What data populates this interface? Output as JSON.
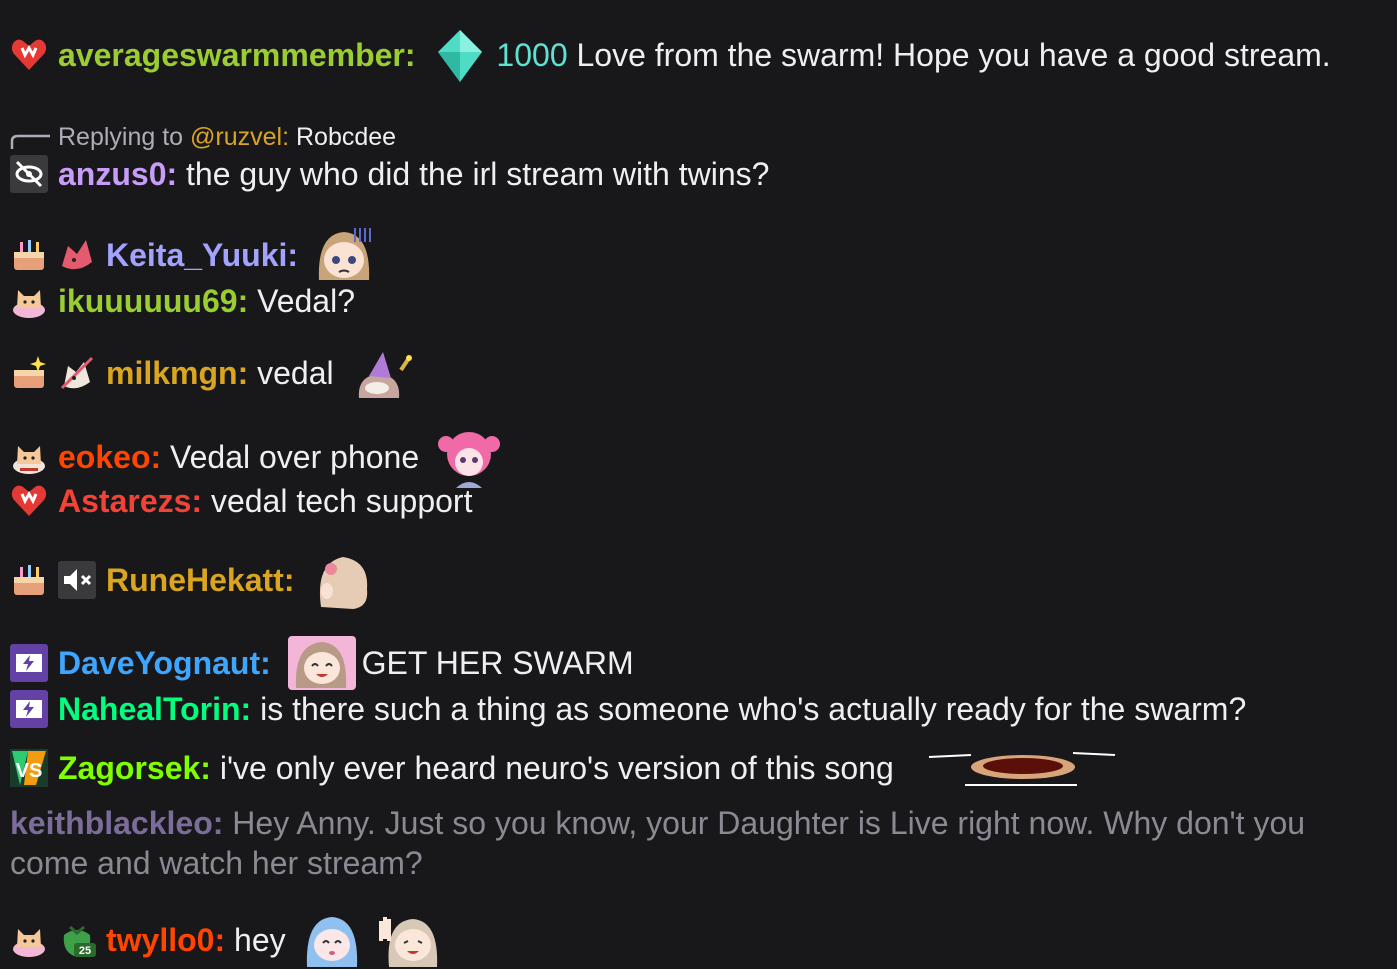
{
  "colors": {
    "background": "#18181b",
    "text": "#efeff1",
    "reply_text": "#adadb8",
    "faded_text": "#8a8a93"
  },
  "messages": [
    {
      "id": "m1",
      "badges": [
        "heart-badge-icon"
      ],
      "user": "averageswarmmember:",
      "user_color": "#9acd32",
      "bits_icon": "bits-gem-icon",
      "bits": "1000",
      "bits_color": "#5ee2d2",
      "text": "Love from the swarm! Hope you have a good stream."
    },
    {
      "id": "m2",
      "reply": {
        "prefix": "Replying to",
        "mention": "@ruzvel:",
        "text": "Robcdee"
      },
      "badges": [
        "eye-slash-badge-icon"
      ],
      "user": "anzus0:",
      "user_color": "#c89df8",
      "text": "the guy who did the irl stream with twins?"
    },
    {
      "id": "m3",
      "badges": [
        "cake-badge-icon",
        "fox-badge-icon"
      ],
      "user": "Keita_Yuuki:",
      "user_color": "#a3a3ff",
      "emotes": [
        "anime-girl-stressed-emote"
      ],
      "text": ""
    },
    {
      "id": "m4",
      "badges": [
        "cat-cake-badge-icon"
      ],
      "user": "ikuuuuuu69:",
      "user_color": "#9acd32",
      "text": "Vedal?"
    },
    {
      "id": "m5",
      "badges": [
        "cake-sparkle-badge-icon",
        "fox-sword-badge-icon"
      ],
      "user": "milkmgn:",
      "user_color": "#daa520",
      "text": "vedal",
      "emotes": [
        "wizard-turtle-emote"
      ]
    },
    {
      "id": "m6",
      "badges": [
        "cat-cake-badge-icon"
      ],
      "user": "eokeo:",
      "user_color": "#ff4500",
      "text": "Vedal over phone",
      "emotes": [
        "pink-hair-girl-emote"
      ]
    },
    {
      "id": "m7",
      "badges": [
        "heart-badge-icon"
      ],
      "user": "Astarezs:",
      "user_color": "#f44336",
      "text": "vedal tech support"
    },
    {
      "id": "m8",
      "badges": [
        "cake-badge-icon",
        "muted-speaker-badge-icon"
      ],
      "user": "RuneHekatt:",
      "user_color": "#daa520",
      "emotes": [
        "anime-girl-back-emote"
      ],
      "text": ""
    },
    {
      "id": "m9",
      "badges": [
        "prime-battery-badge-icon"
      ],
      "user": "DaveYognaut:",
      "user_color": "#3ea6ff",
      "emotes": [
        "anime-girl-happy-emote"
      ],
      "text": "GET HER SWARM"
    },
    {
      "id": "m10",
      "badges": [
        "prime-battery-badge-icon"
      ],
      "user": "NahealTorin:",
      "user_color": "#00ff7f",
      "text": "is there such a thing as someone who's actually ready for the swarm?"
    },
    {
      "id": "m11",
      "badges": [
        "vs-badge-icon"
      ],
      "user": "Zagorsek:",
      "user_color": "#7fff00",
      "text": "i've only ever heard neuro's version of this song",
      "emotes": [
        "flying-pie-emote"
      ]
    },
    {
      "id": "m12",
      "badges": [],
      "user": "keithblackleo:",
      "user_color": "#7c6c99",
      "text": "Hey Anny. Just so you know, your Daughter is Live right now. Why don't you come and watch her stream?"
    },
    {
      "id": "m13",
      "badges": [
        "cat-cake-badge-icon",
        "strawberry-25-badge-icon"
      ],
      "user": "twyllo0:",
      "user_color": "#ff4500",
      "text": "hey",
      "emotes": [
        "blue-hair-girl-emote",
        "girl-wave-emote"
      ]
    }
  ]
}
